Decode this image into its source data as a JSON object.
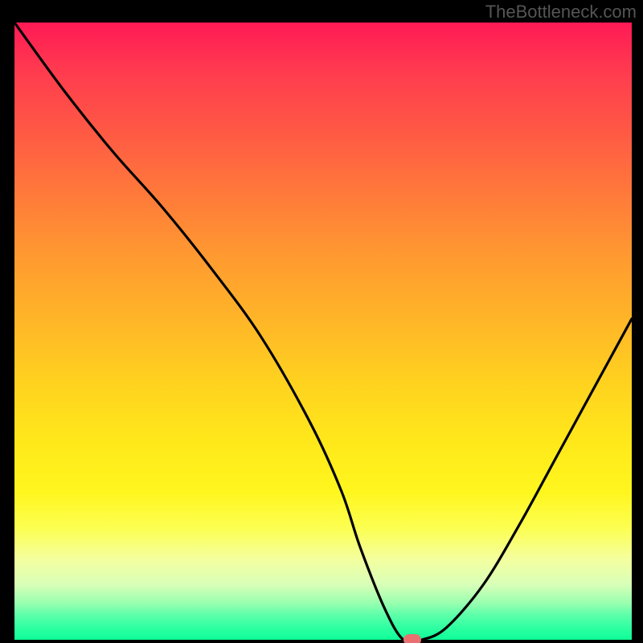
{
  "watermark": "TheBottleneck.com",
  "chart_data": {
    "type": "line",
    "title": "",
    "xlabel": "",
    "ylabel": "",
    "xlim": [
      0,
      100
    ],
    "ylim": [
      0,
      100
    ],
    "x": [
      0,
      8,
      16,
      24,
      32,
      40,
      48,
      53,
      56,
      60,
      63,
      66,
      70,
      76,
      82,
      88,
      94,
      100
    ],
    "values": [
      100,
      89,
      79,
      70,
      60,
      49,
      35,
      24,
      15,
      5,
      0,
      0,
      2,
      9,
      19,
      30,
      41,
      52
    ],
    "marker": {
      "x": 64.5,
      "y": 0
    },
    "gradient_colors": {
      "top": "#ff1a55",
      "mid": "#ffe81a",
      "bottom": "#0eff97"
    }
  }
}
